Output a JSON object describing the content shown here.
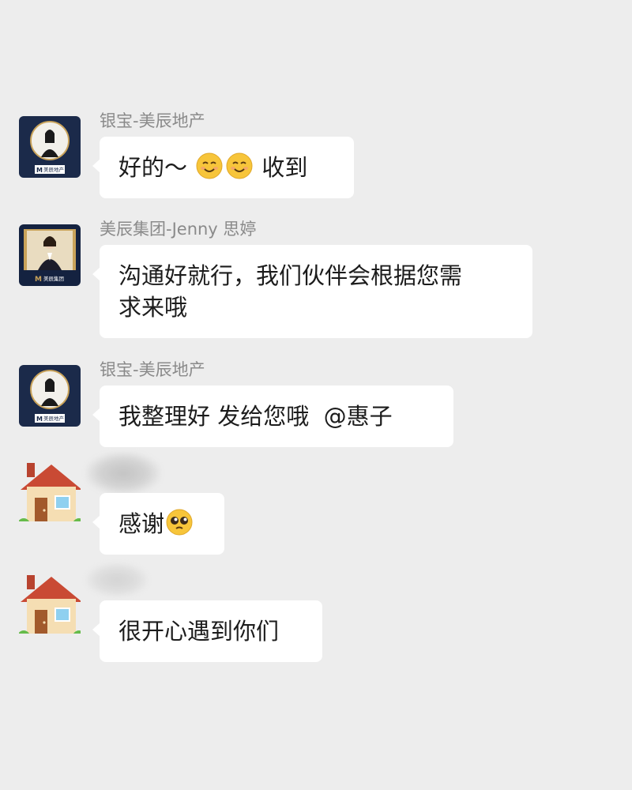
{
  "messages": [
    {
      "sender": "银宝-美辰地产",
      "avatar_caption": "美辰地产",
      "text_before": "好的～ ",
      "emojis": [
        "smiling-face-icon",
        "smiling-face-icon"
      ],
      "text_after": " 收到"
    },
    {
      "sender": "美辰集团-Jenny 思婷",
      "avatar_caption": "美辰集团",
      "line1": "沟通好就行，我们伙伴会根据您需",
      "line2": "求来哦"
    },
    {
      "sender": "银宝-美辰地产",
      "avatar_caption": "美辰地产",
      "text": "我整理好 发给您哦  @惠子"
    },
    {
      "sender_hidden": true,
      "text": "感谢",
      "emoji": "pleading-face-icon"
    },
    {
      "sender_hidden": true,
      "text": "很开心遇到你们"
    }
  ],
  "colors": {
    "background": "#ededed",
    "bubble": "#ffffff",
    "sender_name": "#8a8a8a",
    "text": "#1c1c1c"
  }
}
